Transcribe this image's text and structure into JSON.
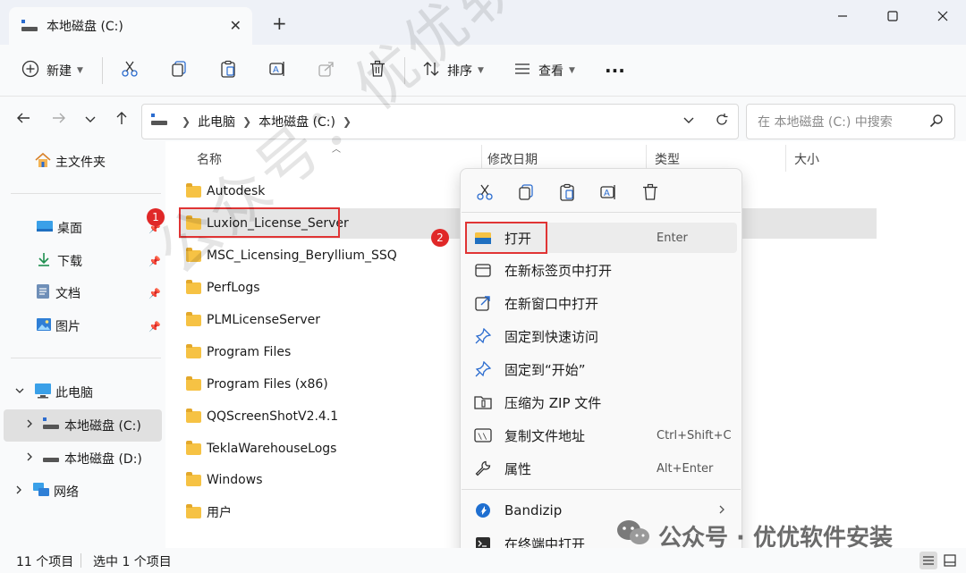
{
  "window": {
    "tab_title": "本地磁盘 (C:)",
    "new_tab": "+",
    "close_tab": "✕"
  },
  "toolbar": {
    "new_label": "新建",
    "sort_label": "排序",
    "view_label": "查看",
    "more": "···"
  },
  "address": {
    "crumbs": [
      "此电脑",
      "本地磁盘 (C:)"
    ],
    "search_placeholder": "在 本地磁盘 (C:) 中搜索"
  },
  "sidebar": {
    "home": "主文件夹",
    "desktop": "桌面",
    "downloads": "下载",
    "documents": "文档",
    "pictures": "图片",
    "this_pc": "此电脑",
    "drive_c": "本地磁盘 (C:)",
    "drive_d": "本地磁盘 (D:)",
    "network": "网络"
  },
  "columns": {
    "name": "名称",
    "modified": "修改日期",
    "type": "类型",
    "size": "大小"
  },
  "files": [
    "Autodesk",
    "Luxion_License_Server",
    "MSC_Licensing_Beryllium_SSQ",
    "PerfLogs",
    "PLMLicenseServer",
    "Program Files",
    "Program Files (x86)",
    "QQScreenShotV2.4.1",
    "TeklaWarehouseLogs",
    "Windows",
    "用户"
  ],
  "context_menu": {
    "open": "打开",
    "open_shortcut": "Enter",
    "open_new_tab": "在新标签页中打开",
    "open_new_window": "在新窗口中打开",
    "pin_quick": "固定到快速访问",
    "pin_start": "固定到“开始”",
    "zip": "压缩为 ZIP 文件",
    "copy_path": "复制文件地址",
    "copy_path_shortcut": "Ctrl+Shift+C",
    "properties": "属性",
    "properties_shortcut": "Alt+Enter",
    "bandizip": "Bandizip",
    "terminal": "在终端中打开"
  },
  "annotations": {
    "badge1": "1",
    "badge2": "2"
  },
  "status": {
    "count": "11 个项目",
    "selected": "选中 1 个项目"
  },
  "watermark": {
    "diagonal": "公众号：优优软件安装",
    "footer": "公众号 · 优优软件安装"
  }
}
